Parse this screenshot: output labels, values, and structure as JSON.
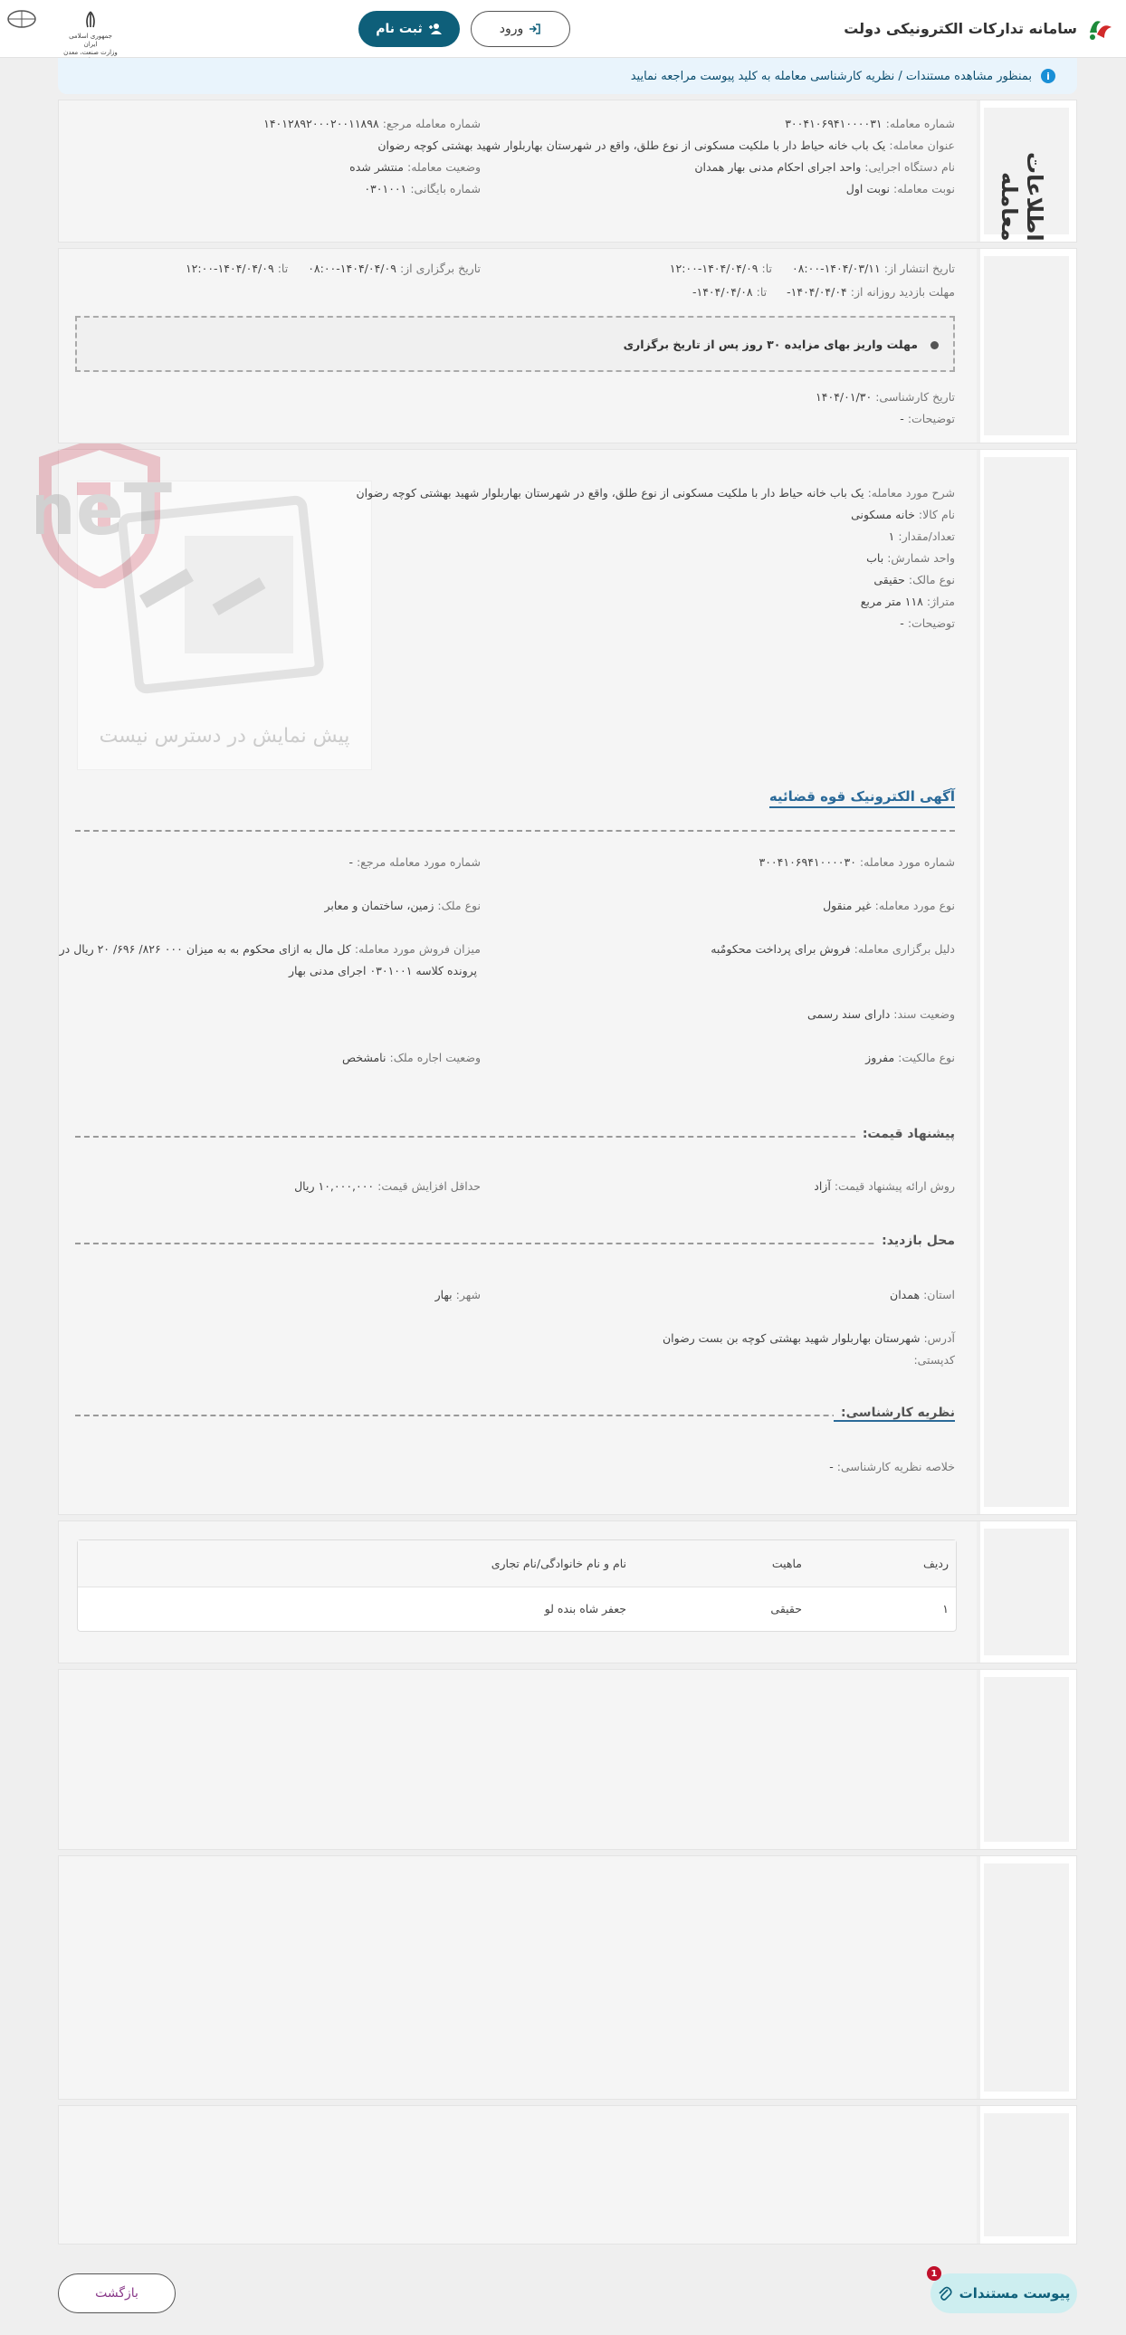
{
  "header": {
    "brand_title": "سامانه تدارکات الکترونیکی دولت",
    "register_label": "ثبت نام",
    "login_label": "ورود",
    "gov_logo_caption": "جمهوری اسلامی ایران\nوزارت صنعت، معدن و تجارت"
  },
  "notice": {
    "text": "بمنظور مشاهده مستندات / نظریه کارشناسی معامله به کلید پیوست مراجعه نمایید"
  },
  "deal_info": {
    "side_title": "اطلاعات معامله",
    "deal_number_label": "شماره معامله:",
    "deal_number": "۳۰۰۴۱۰۶۹۴۱۰۰۰۰۳۱",
    "ref_number_label": "شماره معامله مرجع:",
    "ref_number": "۱۴۰۱۲۸۹۲۰۰۰۲۰۰۱۱۸۹۸",
    "title_label": "عنوان معامله:",
    "title": "یک باب خانه حیاط دار با ملکیت مسکونی از نوع طلق، واقع در شهرستان بهاربلوار شهید بهشتی کوچه رضوان",
    "executor_label": "نام دستگاه اجرایی:",
    "executor": "واحد اجرای احکام مدنی بهار همدان",
    "status_label": "وضعیت معامله:",
    "status": "منتشر شده",
    "turn_label": "نوبت معامله:",
    "turn": "نوبت اول",
    "archive_label": "شماره بایگانی:",
    "archive": "۰۳۰۱۰۰۱"
  },
  "dates": {
    "publish_label": "تاریخ انتشار از:",
    "publish_from": "۱۴۰۴/۰۳/۱۱-۰۸:۰۰",
    "to_label": "تا:",
    "publish_to": "۱۴۰۴/۰۴/۰۹-۱۲:۰۰",
    "holding_label": "تاریخ برگزاری از:",
    "holding_from": "۱۴۰۴/۰۴/۰۹-۰۸:۰۰",
    "holding_to": "۱۴۰۴/۰۴/۰۹-۱۲:۰۰",
    "visit_label": "مهلت بازدید روزانه از:",
    "visit_from": "۱۴۰۴/۰۴/۰۴-",
    "visit_to": "۱۴۰۴/۰۴/۰۸-",
    "deposit_note": "مهلت واریز بهای مزایده ۳۰ روز پس از تاریخ برگزاری",
    "expert_date_label": "تاریخ کارشناسی:",
    "expert_date": "۱۴۰۴/۰۱/۳۰",
    "desc_label": "توضیحات:",
    "desc": "-"
  },
  "item": {
    "desc_label": "شرح مورد معامله:",
    "desc": "یک باب خانه حیاط دار با ملکیت مسکونی از نوع طلق، واقع در شهرستان بهاربلوار شهید بهشتی کوچه رضوان",
    "goods_label": "نام کالا:",
    "goods": "خانه مسکونی",
    "qty_label": "تعداد/مقدار:",
    "qty": "۱",
    "unit_label": "واحد شمارش:",
    "unit": "باب",
    "owner_type_label": "نوع مالک:",
    "owner_type": "حقیقی",
    "area_label": "متراژ:",
    "area": "۱۱۸ متر مربع",
    "notes_label": "توضیحات:",
    "notes": "-",
    "no_preview": "پیش نمایش در دسترس نیست",
    "watermark": "AriaTender.neT"
  },
  "ad": {
    "title": "آگهی الکترونیک قوه قضائیه",
    "item_number_label": "شماره مورد معامله:",
    "item_number": "۳۰۰۴۱۰۶۹۴۱۰۰۰۰۳۰",
    "ref_item_label": "شماره مورد معامله مرجع:",
    "ref_item": "-",
    "item_type_label": "نوع مورد معامله:",
    "item_type": "غیر منقول",
    "prop_type_label": "نوع ملک:",
    "prop_type": "زمین، ساختمان و معابر",
    "reason_label": "دلیل برگزاری معامله:",
    "reason": "فروش برای پرداخت محکومٌبه",
    "sale_amount_label": "میزان فروش مورد معامله:",
    "sale_amount_1": "کل مال به ازای محکوم به به میزان ۰۰۰ ۸۲۶/ ۶۹۶/ ۲۰ ریال در",
    "sale_amount_2": "پرونده کلاسه ۰۳۰۱۰۰۱ اجرای مدنی بهار",
    "doc_status_label": "وضعیت سند:",
    "doc_status": "دارای سند رسمی",
    "ownership_label": "نوع مالکیت:",
    "ownership": "مفروز",
    "lease_label": "وضعیت اجاره ملک:",
    "lease": "نامشخص",
    "price_title": "پیشنهاد قیمت:",
    "price_method_label": "روش ارائه پیشنهاد قیمت:",
    "price_method": "آزاد",
    "min_increase_label": "حداقل افزایش قیمت:",
    "min_increase": "۱۰,۰۰۰,۰۰۰ ریال",
    "visit_title": "محل بازدید:",
    "province_label": "استان:",
    "province": "همدان",
    "city_label": "شهر:",
    "city": "بهار",
    "address_label": "آدرس:",
    "address": "شهرستان بهاربلوار شهید بهشتی کوچه بن بست رضوان",
    "postal_label": "کدپستی:",
    "postal": "",
    "expert_title": "نظریه کارشناسی:",
    "expert_summary_label": "خلاصه نظریه کارشناسی:",
    "expert_summary": "-"
  },
  "table": {
    "headers": [
      "ردیف",
      "ماهیت",
      "نام و نام خانوادگی/نام تجاری"
    ],
    "rows": [
      [
        "۱",
        "حقیقی",
        "جعفر شاه بنده لو"
      ]
    ]
  },
  "footer": {
    "back_label": "بازگشت",
    "attach_label": "پیوست مستندات",
    "attach_badge": "1"
  }
}
